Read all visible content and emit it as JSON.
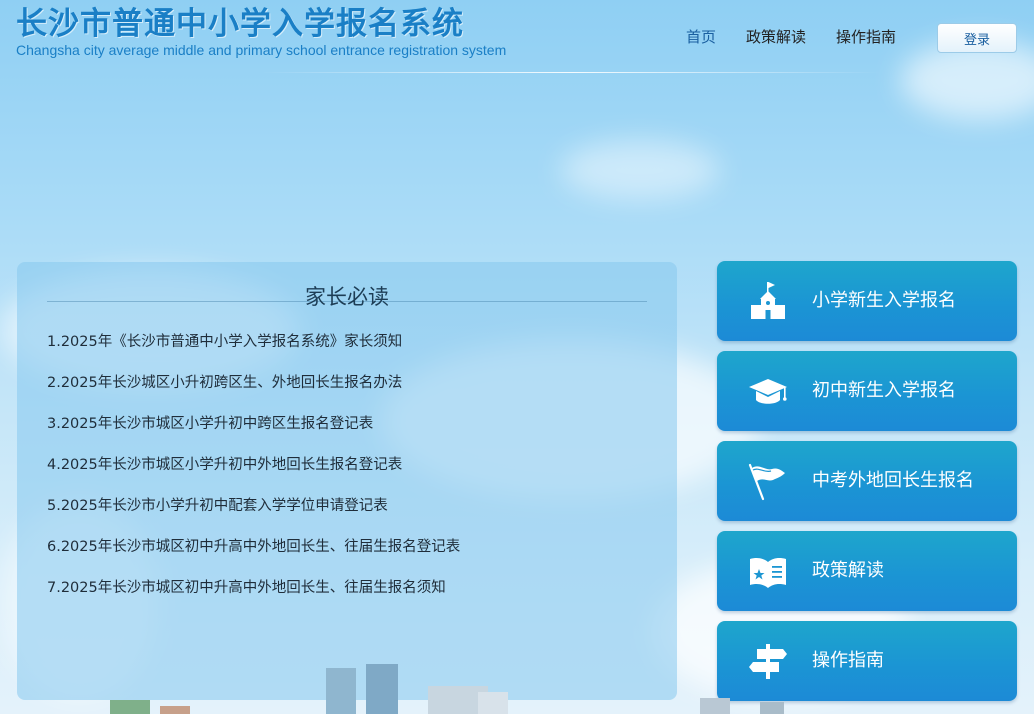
{
  "header": {
    "title": "长沙市普通中小学入学报名系统",
    "subtitle": "Changsha city average middle and primary school entrance registration system",
    "nav": [
      {
        "label": "首页",
        "active": true
      },
      {
        "label": "政策解读",
        "active": false
      },
      {
        "label": "操作指南",
        "active": false
      }
    ],
    "login_label": "登录"
  },
  "notice": {
    "title": "家长必读",
    "items": [
      "1.2025年《长沙市普通中小学入学报名系统》家长须知",
      "2.2025年长沙城区小升初跨区生、外地回长生报名办法",
      "3.2025年长沙市城区小学升初中跨区生报名登记表",
      "4.2025年长沙市城区小学升初中外地回长生报名登记表",
      "5.2025年长沙市小学升初中配套入学学位申请登记表",
      "6.2025年长沙市城区初中升高中外地回长生、往届生报名登记表",
      "7.2025年长沙市城区初中升高中外地回长生、往届生报名须知"
    ]
  },
  "quick_links": [
    {
      "label": "小学新生入学报名",
      "icon": "school-building-icon"
    },
    {
      "label": "初中新生入学报名",
      "icon": "graduation-cap-icon"
    },
    {
      "label": "中考外地回长生报名",
      "icon": "flag-icon"
    },
    {
      "label": "政策解读",
      "icon": "open-book-icon"
    },
    {
      "label": "操作指南",
      "icon": "signpost-icon"
    }
  ],
  "colors": {
    "brand": "#1a7fc6",
    "button_top": "#1ea6cc",
    "button_bottom": "#1c8ad6",
    "sky": "#a9dbf7"
  }
}
